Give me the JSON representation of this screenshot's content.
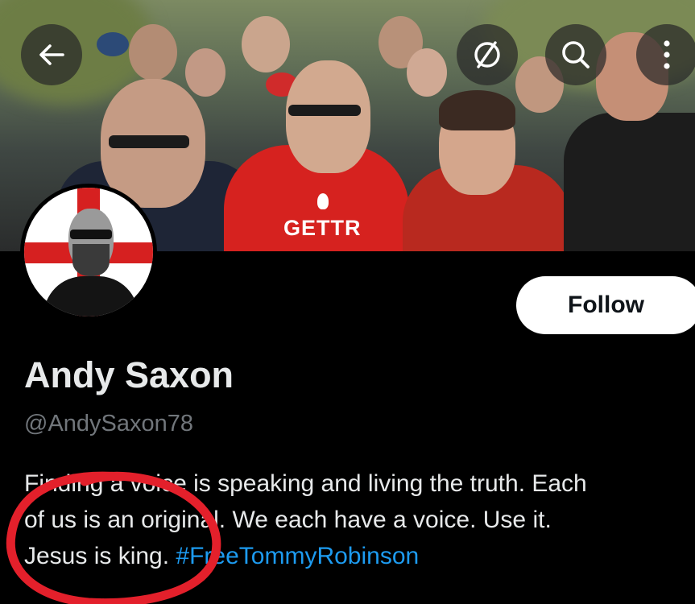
{
  "banner": {
    "shirt_text": "GETTR"
  },
  "header": {
    "back_icon": "arrow-left-icon",
    "grok_icon": "slashed-circle-icon",
    "search_icon": "search-icon",
    "more_icon": "more-vertical-icon"
  },
  "profile": {
    "follow_label": "Follow",
    "display_name": "Andy Saxon",
    "handle": "@AndySaxon78",
    "bio": {
      "line1": "Finding a voice is speaking and living the truth. Each",
      "line2": "of us is an original. We each have a voice. Use it.",
      "line3_text": "Jesus is king.",
      "hashtag": "#FreeTommyRobinson"
    }
  },
  "colors": {
    "background": "#000000",
    "link": "#1d9bf0",
    "annotation_circle": "#e3202b"
  }
}
